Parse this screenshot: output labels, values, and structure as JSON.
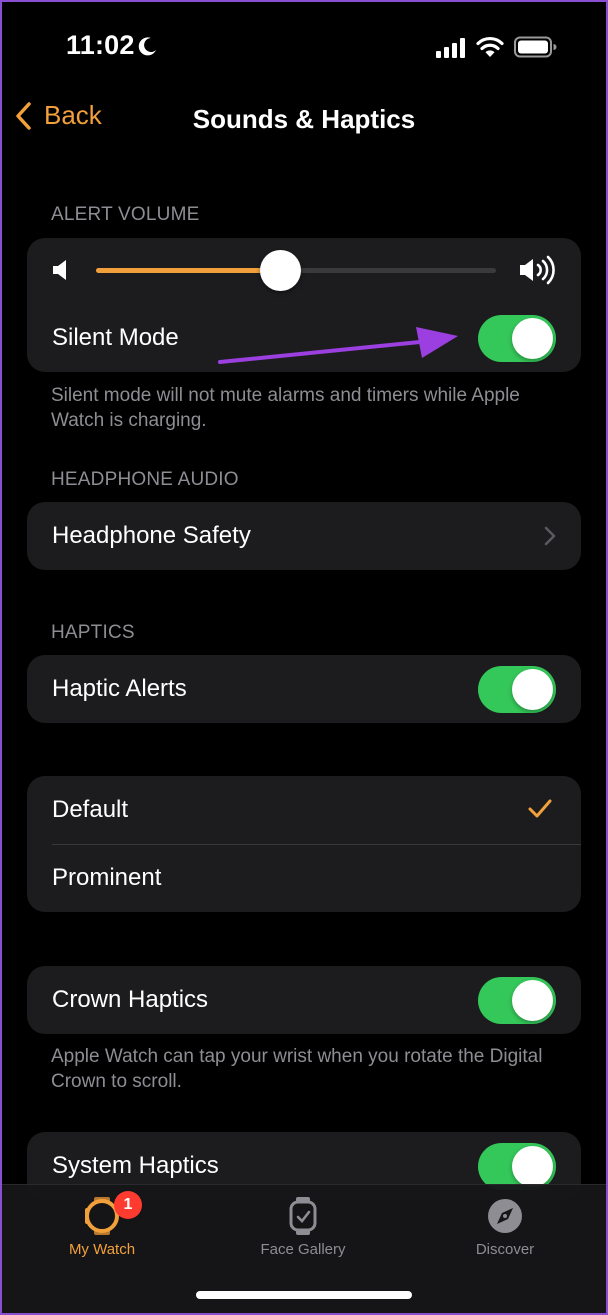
{
  "status_bar": {
    "time": "11:02"
  },
  "nav": {
    "back_label": "Back",
    "title": "Sounds & Haptics"
  },
  "alert_volume": {
    "header": "ALERT VOLUME",
    "slider_value": 0.46,
    "silent_mode_label": "Silent Mode",
    "silent_mode_on": true,
    "footnote": "Silent mode will not mute alarms and timers while Apple Watch is charging."
  },
  "headphone_audio": {
    "header": "HEADPHONE AUDIO",
    "headphone_safety_label": "Headphone Safety"
  },
  "haptics": {
    "header": "HAPTICS",
    "haptic_alerts_label": "Haptic Alerts",
    "haptic_alerts_on": true,
    "options": [
      {
        "label": "Default",
        "selected": true
      },
      {
        "label": "Prominent",
        "selected": false
      }
    ],
    "crown_haptics_label": "Crown Haptics",
    "crown_haptics_on": true,
    "crown_footnote": "Apple Watch can tap your wrist when you rotate the Digital Crown to scroll.",
    "system_haptics_label": "System Haptics",
    "system_haptics_on": true
  },
  "tab_bar": {
    "tabs": [
      {
        "label": "My Watch",
        "icon": "watch-icon",
        "active": true,
        "badge": "1"
      },
      {
        "label": "Face Gallery",
        "icon": "watch-face-icon",
        "active": false
      },
      {
        "label": "Discover",
        "icon": "compass-icon",
        "active": false
      }
    ]
  },
  "colors": {
    "accent": "#f2a03b",
    "toggle_on": "#34c759",
    "annotation_arrow": "#9b3fe0",
    "badge": "#ff3b30"
  }
}
